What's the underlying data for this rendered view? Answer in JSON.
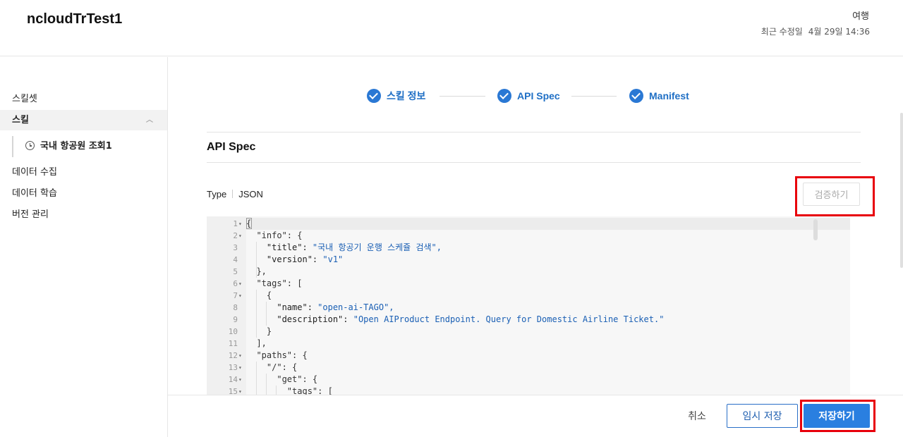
{
  "header": {
    "title": "ncloudTrTest1",
    "category": "여행",
    "modified_label": "최근 수정일",
    "modified_value": "4월 29일 14:36"
  },
  "sidebar": {
    "items": [
      {
        "label": "스킬셋"
      },
      {
        "label": "스킬",
        "expanded": true
      },
      {
        "label": "데이터 수집"
      },
      {
        "label": "데이터 학습"
      },
      {
        "label": "버전 관리"
      }
    ],
    "sub_item": {
      "label": "국내 항공원 조회1",
      "icon": "clock-icon"
    }
  },
  "steps": [
    {
      "label": "스킬 정보",
      "done": true
    },
    {
      "label": "API Spec",
      "done": true
    },
    {
      "label": "Manifest",
      "done": true
    }
  ],
  "section": {
    "title": "API Spec",
    "type_label": "Type",
    "type_value": "JSON",
    "validate_label": "검증하기"
  },
  "editor": {
    "lines": [
      {
        "n": "1",
        "fold": true,
        "text": "{"
      },
      {
        "n": "2",
        "fold": true,
        "text": "  \"info\": {"
      },
      {
        "n": "3",
        "fold": false,
        "text": "    \"title\": \"국내 항공기 운행 스케쥴 검색\","
      },
      {
        "n": "4",
        "fold": false,
        "text": "    \"version\": \"v1\""
      },
      {
        "n": "5",
        "fold": false,
        "text": "  },"
      },
      {
        "n": "6",
        "fold": true,
        "text": "  \"tags\": ["
      },
      {
        "n": "7",
        "fold": true,
        "text": "    {"
      },
      {
        "n": "8",
        "fold": false,
        "text": "      \"name\": \"open-ai-TAGO\","
      },
      {
        "n": "9",
        "fold": false,
        "text": "      \"description\": \"Open AIProduct Endpoint. Query for Domestic Airline Ticket.\""
      },
      {
        "n": "10",
        "fold": false,
        "text": "    }"
      },
      {
        "n": "11",
        "fold": false,
        "text": "  ],"
      },
      {
        "n": "12",
        "fold": true,
        "text": "  \"paths\": {"
      },
      {
        "n": "13",
        "fold": true,
        "text": "    \"/\": {"
      },
      {
        "n": "14",
        "fold": true,
        "text": "      \"get\": {"
      },
      {
        "n": "15",
        "fold": true,
        "text": "        \"tags\": ["
      }
    ]
  },
  "footer": {
    "cancel_label": "취소",
    "temp_save_label": "임시 저장",
    "save_label": "저장하기"
  },
  "colors": {
    "accent": "#2a7fe0",
    "step": "#1f6fc5",
    "highlight": "#e8000b",
    "string": "#1a5fb4"
  }
}
